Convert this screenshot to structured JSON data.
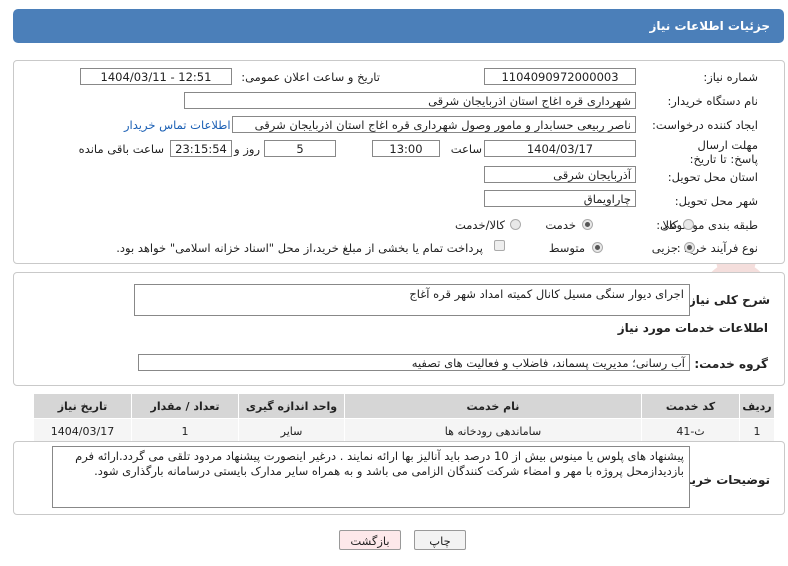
{
  "header": {
    "title": "جزئیات اطلاعات نیاز"
  },
  "form": {
    "need_number_label": "شماره نیاز:",
    "need_number": "1104090972000003",
    "announce_label": "تاریخ و ساعت اعلان عمومی:",
    "announce_value": "1404/03/11 - 12:51",
    "buyer_org_label": "نام دستگاه خریدار:",
    "buyer_org": "شهرداری قره اغاج استان اذربایجان شرقی",
    "creator_label": "ایجاد کننده درخواست:",
    "creator": "ناصر  ربیعی  حسابدار و مامور وصول  شهرداری قره اغاج استان اذربایجان شرقی",
    "contact_link": "اطلاعات تماس خریدار",
    "deadline_label": "مهلت ارسال پاسخ: تا تاریخ:",
    "deadline_date": "1404/03/17",
    "time_label": "ساعت",
    "deadline_time": "13:00",
    "days_value": "5",
    "days_label": "روز و",
    "remaining_time": "23:15:54",
    "remaining_label": "ساعت باقی مانده",
    "province_label": "استان محل تحویل:",
    "province": "آذربایجان شرقی",
    "city_label": "شهر محل تحویل:",
    "city": "چاراویماق",
    "category_label": "طبقه بندی موضوعی:",
    "category_options": [
      "کالا",
      "خدمت",
      "کالا/خدمت"
    ],
    "category_selected": "خدمت",
    "process_label": "نوع فرآیند خرید :",
    "process_options": [
      "جزیی",
      "متوسط"
    ],
    "process_selected": "جزیی",
    "payment_note": "پرداخت تمام یا بخشی از مبلغ خرید،از محل \"اسناد خزانه اسلامی\" خواهد بود."
  },
  "summary": {
    "label": "شرح کلی نیاز:",
    "value": "اجرای دیوار سنگی مسیل کانال کمیته امداد شهر قره آغاج"
  },
  "services": {
    "section_title": "اطلاعات خدمات مورد نیاز",
    "group_label": "گروه خدمت:",
    "group_value": "آب رسانی؛ مدیریت پسماند، فاضلاب و فعالیت های تصفیه",
    "columns": [
      "ردیف",
      "کد خدمت",
      "نام خدمت",
      "واحد اندازه گیری",
      "تعداد / مقدار",
      "تاریخ نیاز"
    ],
    "rows": [
      [
        "1",
        "ث-41",
        "ساماندهی رودخانه ها",
        "سایر",
        "1",
        "1404/03/17"
      ]
    ]
  },
  "buyer_notes": {
    "label": "توضیحات خریدار:",
    "text": "پیشنهاد های پلوس یا مینوس بیش از 10 درصد باید آنالیز بها ارائه نمایند . درغیر اینصورت پیشنهاد مردود تلقی می گردد.ارائه فرم بازدیدازمحل پروژه با مهر و امضاء شرکت کنندگان الزامی می باشد و به همراه سایر مدارک بایستی درسامانه بارگذاری شود."
  },
  "buttons": {
    "print": "چاپ",
    "back": "بازگشت"
  },
  "watermark": {
    "text": "AriaTender.net"
  },
  "colors": {
    "header": "#4b7fb9",
    "link": "#1a5fb4",
    "back_button": "#fde8ea"
  }
}
